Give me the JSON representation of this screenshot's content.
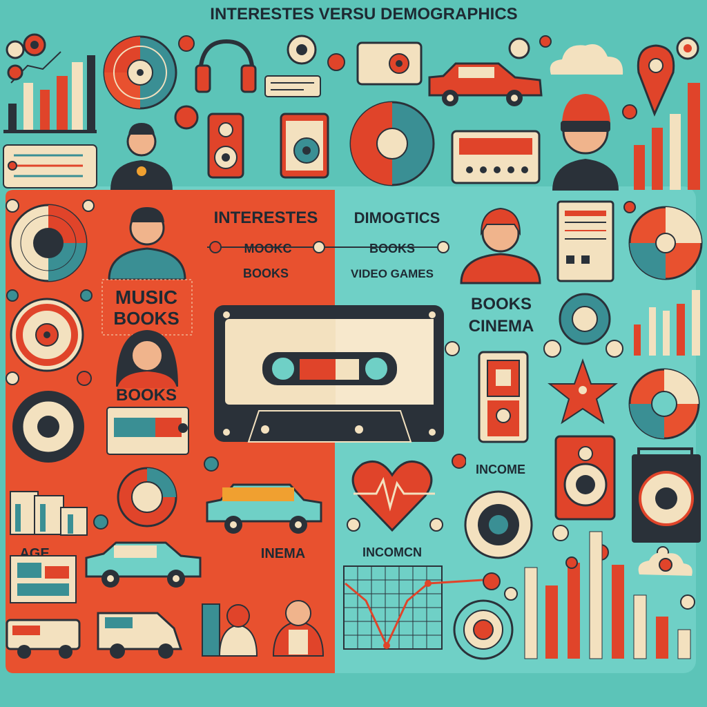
{
  "header": {
    "title": "INTERESTES VERSU DEMOGRAPHICS"
  },
  "center_headers": {
    "left": "INTERESTES",
    "right": "DIMOGTICS"
  },
  "center_rows": {
    "left_row1": "MOOKC",
    "left_row2": "BOOKS",
    "right_row1": "BOOKS",
    "right_row2": "VIDEO GAMES"
  },
  "left_labels": {
    "music": "MUSIC",
    "books1": "BOOKS",
    "books2": "BOOKS",
    "age": "AGE",
    "inema": "INEMA"
  },
  "right_labels": {
    "books": "BOOKS",
    "cinema": "CINEMA",
    "income": "INCOME",
    "incomen": "INCOMCN"
  },
  "colors": {
    "background": "#5cc4b8",
    "left_panel": "#e8512f",
    "accent_red": "#e0442a",
    "cream": "#f3e1bf",
    "dark": "#2a3139",
    "teal_dark": "#3a8f94"
  },
  "icons": [
    "headphones-icon",
    "vinyl-record-icon",
    "cassette-tape-icon",
    "car-icon",
    "van-icon",
    "speaker-icon",
    "heart-pulse-icon",
    "star-icon",
    "cloud-icon",
    "person-avatar-icon",
    "bar-chart-icon",
    "pie-chart-icon",
    "radio-icon",
    "line-graph-icon"
  ]
}
